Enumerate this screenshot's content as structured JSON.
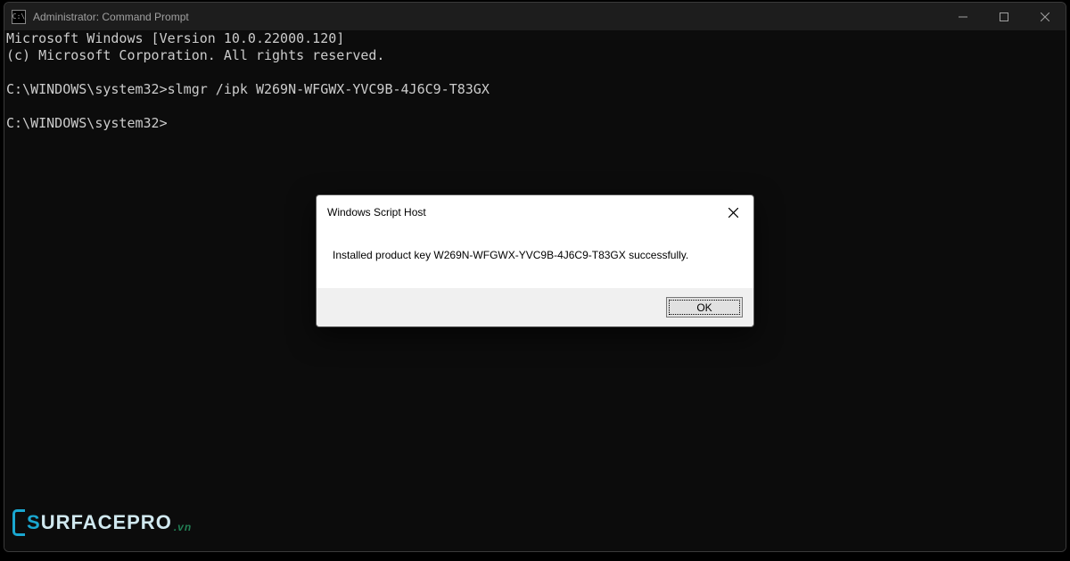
{
  "titlebar": {
    "icon_text": "C:\\",
    "title": "Administrator: Command Prompt"
  },
  "terminal": {
    "line1": "Microsoft Windows [Version 10.0.22000.120]",
    "line2": "(c) Microsoft Corporation. All rights reserved.",
    "blank1": "",
    "line3": "C:\\WINDOWS\\system32>slmgr /ipk W269N-WFGWX-YVC9B-4J6C9-T83GX",
    "blank2": "",
    "line4": "C:\\WINDOWS\\system32>"
  },
  "dialog": {
    "title": "Windows Script Host",
    "message": "Installed product key W269N-WFGWX-YVC9B-4J6C9-T83GX successfully.",
    "ok_label": "OK"
  },
  "watermark": {
    "s": "S",
    "rest": "URFACEPRO",
    "vn": ".vn"
  }
}
